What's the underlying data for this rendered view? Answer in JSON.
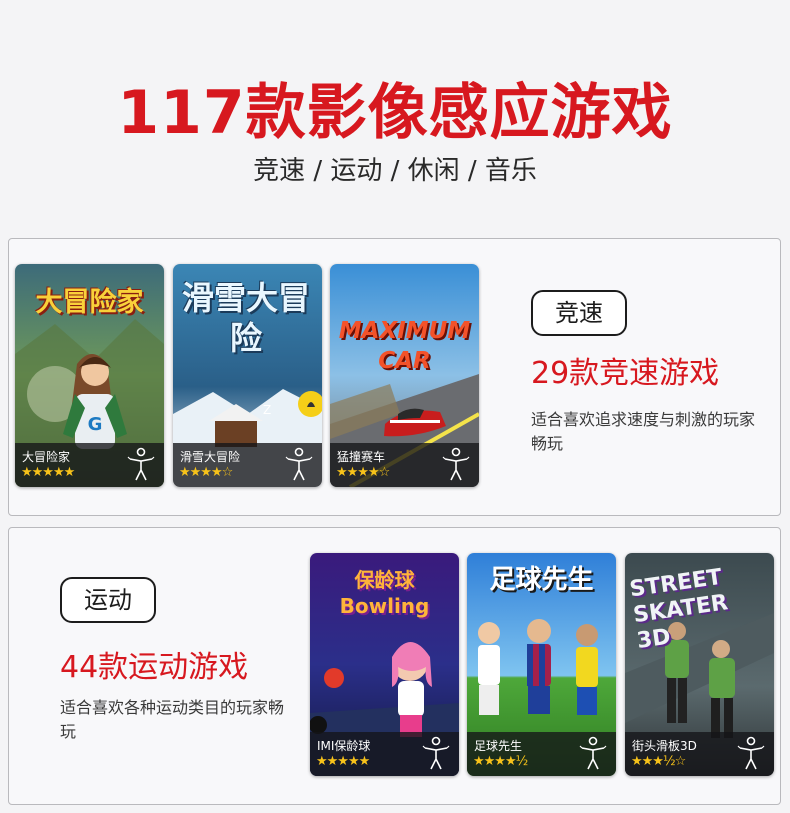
{
  "header": {
    "title": "117款影像感应游戏",
    "subtitle": "竞速 / 运动 / 休闲 / 音乐"
  },
  "sections": [
    {
      "badge": "竞速",
      "count_text": "29款竞速游戏",
      "description": "适合喜欢追求速度与刺激的玩家畅玩",
      "games": [
        {
          "name": "大冒险家",
          "rating": 5,
          "art_title": "大冒险家"
        },
        {
          "name": "滑雪大冒险",
          "rating": 4,
          "art_title": "滑雪大冒险"
        },
        {
          "name": "猛撞赛车",
          "rating": 4,
          "art_title": "MAXIMUM CAR"
        }
      ]
    },
    {
      "badge": "运动",
      "count_text": "44款运动游戏",
      "description": "适合喜欢各种运动类目的玩家畅玩",
      "games": [
        {
          "name": "IMI保龄球",
          "rating": 5,
          "art_title": "保龄球 Bowling"
        },
        {
          "name": "足球先生",
          "rating": 4.5,
          "art_title": "足球先生"
        },
        {
          "name": "街头滑板3D",
          "rating": 3.5,
          "art_title": "STREET SKATER 3D"
        }
      ]
    }
  ],
  "colors": {
    "accent": "#d7181f",
    "star": "#f7c21a"
  },
  "icons": {
    "motion": "motion-sensing-person-icon"
  }
}
